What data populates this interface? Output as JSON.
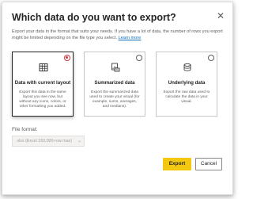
{
  "dialog": {
    "title": "Which data do you want to export?",
    "close_icon": "close-icon",
    "description": "Export your data in the format that suits your needs. If you have a lot of data, the number of rows you export might be limited depending on the file type you select.",
    "learn_more": "Learn more"
  },
  "options": [
    {
      "title": "Data with current layout",
      "description": "Export this data in the same layout you see now, but without any icons, colors, or other formatting you added.",
      "icon": "table-icon",
      "selected": true
    },
    {
      "title": "Summarized data",
      "description": "Export the summarized data used to create your visual (for example, sums, averages, and medians).",
      "icon": "summarized-data-icon",
      "selected": false
    },
    {
      "title": "Underlying data",
      "description": "Export the raw data used to calculate the data in your visual.",
      "icon": "underlying-data-icon",
      "selected": false
    }
  ],
  "file_format": {
    "label": "File format:",
    "value": ".xlsx (Excel 150,000-row max)"
  },
  "buttons": {
    "export": "Export",
    "cancel": "Cancel"
  },
  "colors": {
    "export_button": "#f2c811",
    "selected_radio": "#d13438",
    "link": "#0f6cbd"
  }
}
